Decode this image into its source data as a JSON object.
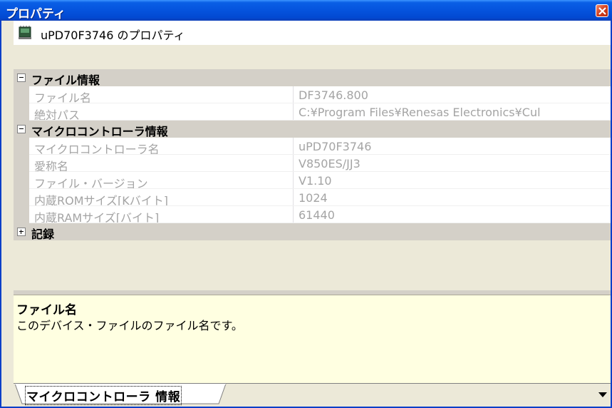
{
  "window": {
    "title": "プロパティ"
  },
  "header": {
    "title": "uPD70F3746 のプロパティ"
  },
  "categories": [
    {
      "label": "ファイル情報",
      "expanded": true,
      "properties": [
        {
          "name": "ファイル名",
          "value": "DF3746.800"
        },
        {
          "name": "絶対パス",
          "value": "C:¥Program Files¥Renesas Electronics¥Cul"
        }
      ]
    },
    {
      "label": "マイクロコントローラ情報",
      "expanded": true,
      "properties": [
        {
          "name": "マイクロコントローラ名",
          "value": "uPD70F3746"
        },
        {
          "name": "愛称名",
          "value": "V850ES/JJ3"
        },
        {
          "name": "ファイル・バージョン",
          "value": "V1.10"
        },
        {
          "name": "内蔵ROMサイズ[Kバイト]",
          "value": "1024"
        },
        {
          "name": "内蔵RAMサイズ[バイト]",
          "value": "61440"
        }
      ]
    },
    {
      "label": "記録",
      "expanded": false,
      "properties": []
    }
  ],
  "description": {
    "title": "ファイル名",
    "text": "このデバイス・ファイルのファイル名です。"
  },
  "tabs": [
    {
      "label": "マイクロコントローラ 情報",
      "active": true
    }
  ],
  "colors": {
    "titlebar": "#0553dd",
    "grid_background": "#ece9d8",
    "description_background": "#ffffe1",
    "readonly_text": "#a4a4a4"
  }
}
